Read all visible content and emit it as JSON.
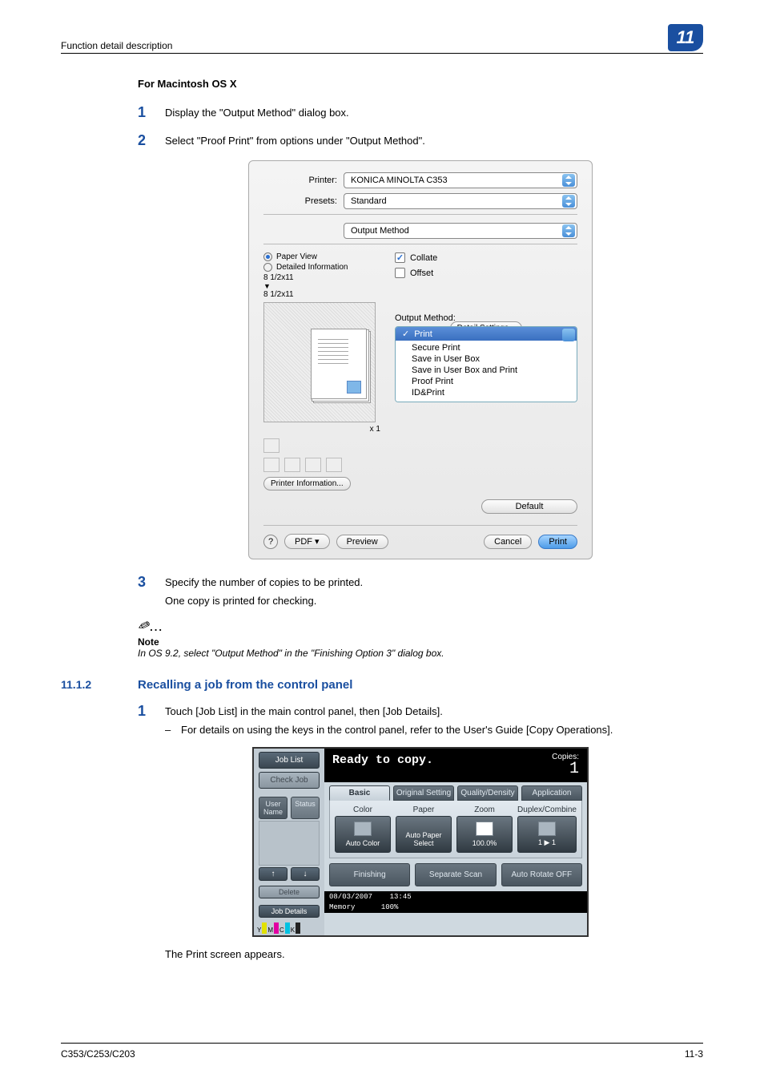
{
  "header": {
    "left": "Function detail description",
    "num": "11"
  },
  "s1": {
    "title": "For Macintosh OS X",
    "step1": "Display the \"Output Method\" dialog box.",
    "step2": "Select \"Proof Print\" from options under \"Output Method\"."
  },
  "dialog": {
    "printer_lbl": "Printer:",
    "printer_val": "KONICA MINOLTA C353",
    "presets_lbl": "Presets:",
    "presets_val": "Standard",
    "section_val": "Output Method",
    "radio1": "Paper View",
    "radio2": "Detailed Information",
    "size1": "8 1/2x11",
    "size2": "8 1/2x11",
    "x1": "x 1",
    "collate": "Collate",
    "offset": "Offset",
    "om_label": "Output Method:",
    "om_selected": "Print",
    "om_opts": [
      "Secure Print",
      "Save in User Box",
      "Save in User Box and Print",
      "Proof Print",
      "ID&Print"
    ],
    "printer_info": "Printer Information...",
    "detail_settings": "Detail Settings...",
    "default": "Default",
    "help": "?",
    "pdf": "PDF ▾",
    "preview": "Preview",
    "cancel": "Cancel",
    "print": "Print"
  },
  "s2": {
    "step3a": "Specify the number of copies to be printed.",
    "step3b": "One copy is printed for checking."
  },
  "note": {
    "label": "Note",
    "text": "In OS 9.2, select \"Output Method\" in the \"Finishing Option 3\" dialog box."
  },
  "h3": {
    "num": "11.1.2",
    "text": "Recalling a job from the control panel"
  },
  "s3": {
    "step1": "Touch [Job List] in the main control panel, then [Job Details].",
    "sub1": "For details on using the keys in the control panel, refer to the User's Guide [Copy Operations]."
  },
  "panel": {
    "joblist": "Job List",
    "checkjob": "Check Job",
    "username": "User Name",
    "status": "Status",
    "delete": "Delete",
    "jobdetails": "Job Details",
    "title": "Ready to copy.",
    "copies_lbl": "Copies:",
    "copies_val": "1",
    "tabs": [
      "Basic",
      "Original Setting",
      "Quality/Density",
      "Application"
    ],
    "cols": {
      "color_h": "Color",
      "color_v": "Auto Color",
      "paper_h": "Paper",
      "paper_v": "Auto Paper Select",
      "zoom_h": "Zoom",
      "zoom_v": "100.0%",
      "dup_h": "Duplex/Combine",
      "dup_v": "1 ▶ 1"
    },
    "bottom": {
      "finishing": "Finishing",
      "sep": "Separate Scan",
      "auto": "Auto Rotate OFF"
    },
    "status_date": "08/03/2007",
    "status_time": "13:45",
    "status_mem": "Memory",
    "status_mem_v": "100%",
    "ymck": [
      "Y",
      "M",
      "C",
      "K"
    ]
  },
  "after_panel": "The Print screen appears.",
  "footer": {
    "left": "C353/C253/C203",
    "right": "11-3"
  }
}
